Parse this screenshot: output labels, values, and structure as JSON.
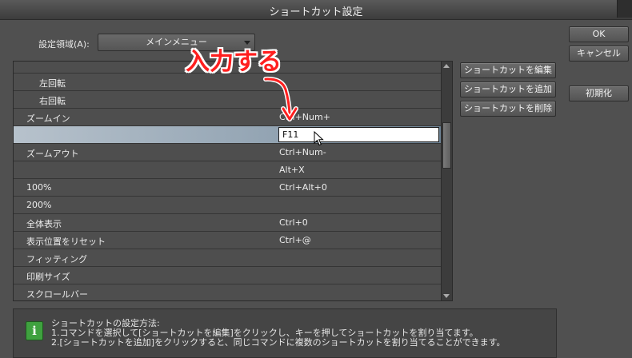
{
  "window": {
    "title": "ショートカット設定"
  },
  "settings_area": {
    "label": "設定領域(A):",
    "selected": "メインメニュー"
  },
  "buttons": {
    "ok": "OK",
    "cancel": "キャンセル",
    "edit_shortcut": "ショートカットを編集",
    "add_shortcut": "ショートカットを追加",
    "delete_shortcut": "ショートカットを削除",
    "reset": "初期化"
  },
  "list": {
    "rows": [
      {
        "name": "左回転",
        "key": "",
        "sub": true
      },
      {
        "name": "右回転",
        "key": "",
        "sub": true
      },
      {
        "name": "ズームイン",
        "key": "Ctrl+Num+"
      },
      {
        "name": "",
        "key": "F11",
        "editing": true
      },
      {
        "name": "ズームアウト",
        "key": "Ctrl+Num-"
      },
      {
        "name": "",
        "key": "Alt+X"
      },
      {
        "name": "100%",
        "key": "Ctrl+Alt+0"
      },
      {
        "name": "200%",
        "key": ""
      },
      {
        "name": "全体表示",
        "key": "Ctrl+0"
      },
      {
        "name": "表示位置をリセット",
        "key": "Ctrl+@"
      },
      {
        "name": "フィッティング",
        "key": ""
      },
      {
        "name": "印刷サイズ",
        "key": ""
      },
      {
        "name": "スクロールバー",
        "key": ""
      }
    ]
  },
  "info": {
    "title": "ショートカットの設定方法:",
    "line1": "1.コマンドを選択して[ショートカットを編集]をクリックし、キーを押してショートカットを割り当てます。",
    "line2": "2.[ショートカットを追加]をクリックすると、同じコマンドに複数のショートカットを割り当てることができます。"
  },
  "annotation": {
    "text": "入力する",
    "color": "#ff1f1f"
  }
}
